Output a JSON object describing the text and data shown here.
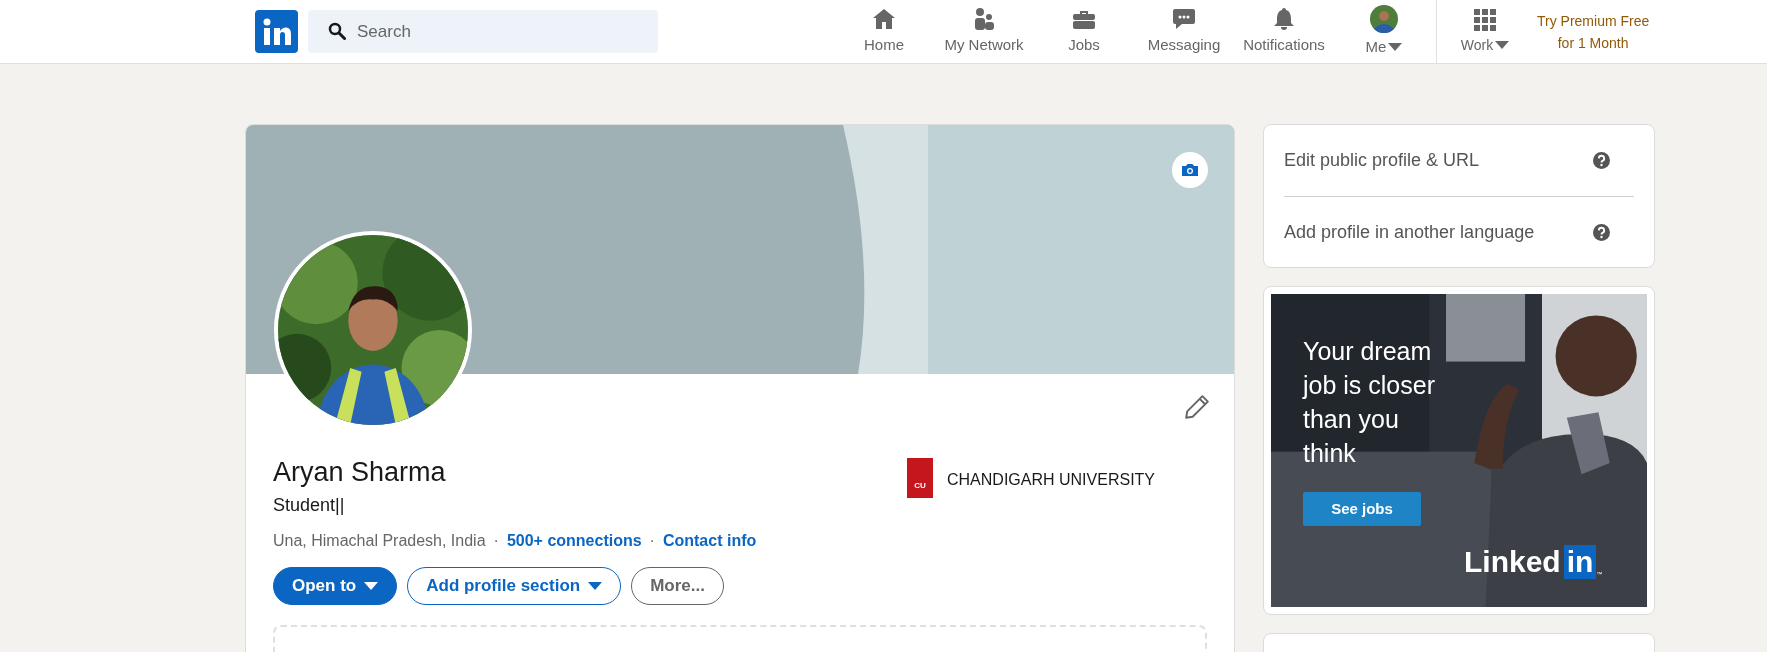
{
  "nav": {
    "search": {
      "placeholder": "Search"
    },
    "items": [
      {
        "label": "Home",
        "kind": "home",
        "selected": false,
        "caret": false
      },
      {
        "label": "My Network",
        "kind": "network",
        "selected": false,
        "caret": false
      },
      {
        "label": "Jobs",
        "kind": "jobs",
        "selected": false,
        "caret": false
      },
      {
        "label": "Messaging",
        "kind": "messaging",
        "selected": false,
        "caret": false
      },
      {
        "label": "Notifications",
        "kind": "notifications",
        "selected": false,
        "caret": false
      },
      {
        "label": "Me",
        "kind": "avatar",
        "selected": false,
        "caret": true
      }
    ],
    "work": {
      "label": "Work"
    },
    "premium": {
      "lines": [
        "Try Premium Free",
        "for 1 Month"
      ]
    }
  },
  "profile": {
    "name": "Aryan Sharma",
    "headline": "Student||",
    "location": "Una, Himachal Pradesh, India",
    "separator": "·",
    "connections": "500+ connections",
    "contact": "Contact info",
    "school": {
      "name": "CHANDIGARH UNIVERSITY",
      "logo_text": "CU"
    },
    "buttons": [
      {
        "label": "Open to",
        "kind": "primary",
        "caret": true
      },
      {
        "label": "Add profile section",
        "kind": "outline",
        "caret": true
      },
      {
        "label": "More...",
        "kind": "muted",
        "caret": false
      }
    ]
  },
  "sidebar": {
    "links": [
      {
        "label": "Edit public profile & URL"
      },
      {
        "label": "Add profile in another language"
      }
    ],
    "ad": {
      "headline": "Your dream job is closer than you think",
      "button": "See jobs",
      "logo_word": "Linked",
      "logo_box": "in",
      "logo_mark": "™"
    }
  }
}
